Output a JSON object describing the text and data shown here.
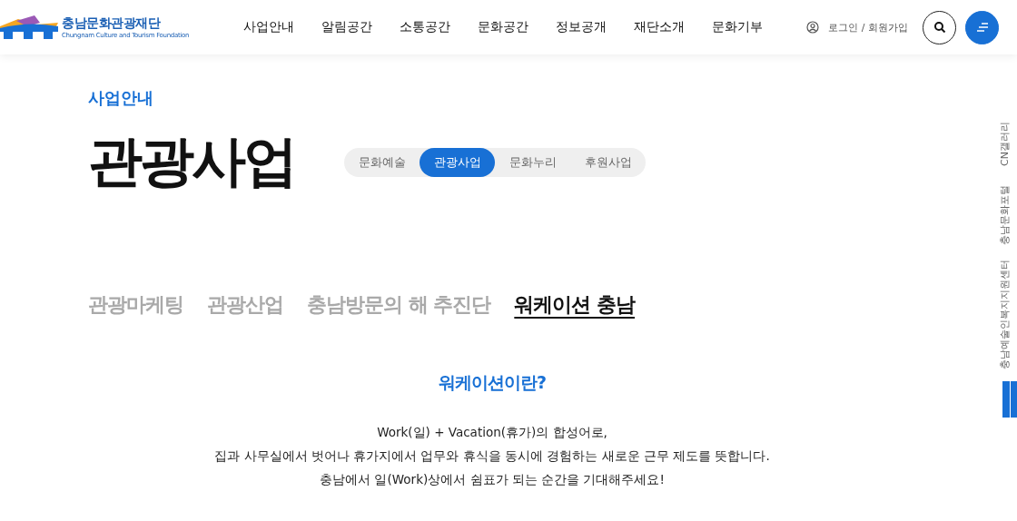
{
  "logo": {
    "name": "충남문화관광재단",
    "subtitle": "Chungnam Culture and Tourism Foundation"
  },
  "nav": [
    {
      "label": "사업안내"
    },
    {
      "label": "알림공간"
    },
    {
      "label": "소통공간"
    },
    {
      "label": "문화공간"
    },
    {
      "label": "정보공개"
    },
    {
      "label": "재단소개"
    },
    {
      "label": "문화기부"
    }
  ],
  "account": {
    "login": "로그인 / 회원가입"
  },
  "breadcrumb": "사업안내",
  "page_title": "관광사업",
  "category_tabs": [
    {
      "label": "문화예술",
      "selected": false
    },
    {
      "label": "관광사업",
      "selected": true
    },
    {
      "label": "문화누리",
      "selected": false
    },
    {
      "label": "후원사업",
      "selected": false
    }
  ],
  "sub_tabs": [
    {
      "label": "관광마케팅",
      "selected": false
    },
    {
      "label": "관광산업",
      "selected": false
    },
    {
      "label": "충남방문의 해 추진단",
      "selected": false
    },
    {
      "label": "워케이션 충남",
      "selected": true
    }
  ],
  "section": {
    "heading": "워케이션이란?",
    "lines": [
      "Work(일) + Vacation(휴가)의 합성어로,",
      "집과 사무실에서 벗어나 휴가지에서 업무와 휴식을 동시에 경험하는 새로운 근무 제도를 뜻합니다.",
      "충남에서 일(Work)상에서 쉼표가 되는 순간을 기대해주세요!"
    ]
  },
  "side_links": [
    {
      "label": "CN갤러리"
    },
    {
      "label": "충남문화포털"
    },
    {
      "label": "충남예술인복지지원센터"
    }
  ]
}
